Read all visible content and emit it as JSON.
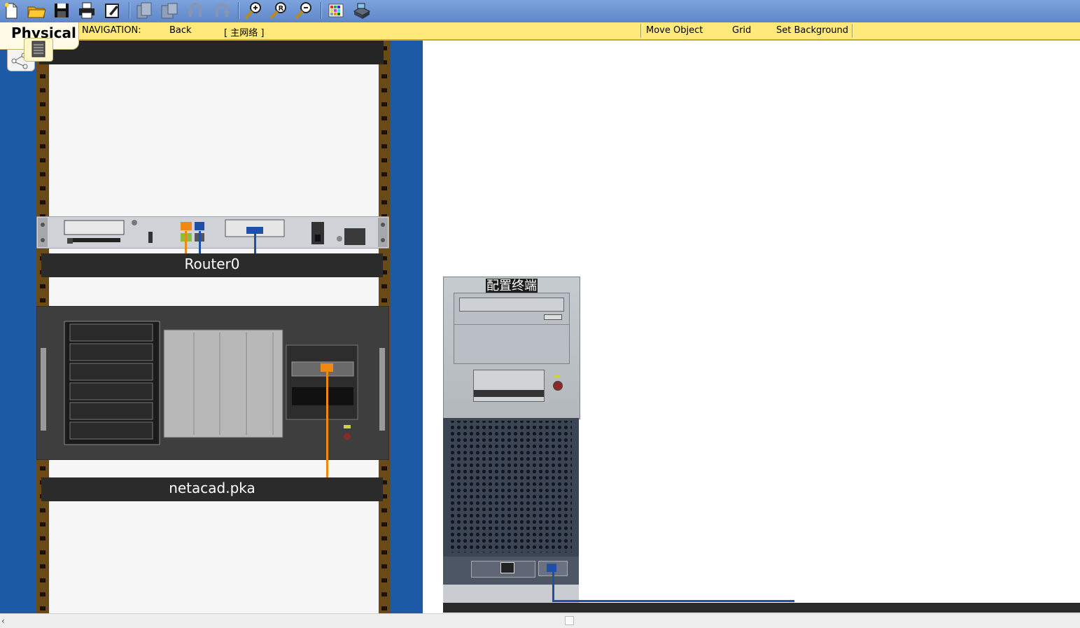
{
  "toolbar": {
    "icons": [
      "new-file-icon",
      "open-folder-icon",
      "save-icon",
      "print-icon",
      "edit-icon",
      "copy-icon",
      "paste-icon",
      "undo-icon",
      "redo-icon",
      "zoom-in-icon",
      "zoom-reset-icon",
      "zoom-out-icon",
      "palette-icon",
      "device-icon"
    ]
  },
  "nav": {
    "tab": "Physical",
    "navigation_label": "NAVIGATION:",
    "back": "Back",
    "location": "[ 主网络 ]",
    "move_object": "Move Object",
    "grid": "Grid",
    "set_background": "Set Background"
  },
  "devices": {
    "router_label": "Router0",
    "server_label": "netacad.pka",
    "pc_label": "配置终端"
  },
  "colors": {
    "toolbar": "#6f95d4",
    "navbar": "#fee97a",
    "rack_blue": "#1c5aa6",
    "console_cable": "#f0890f",
    "serial_cable": "#1f4fa8"
  }
}
